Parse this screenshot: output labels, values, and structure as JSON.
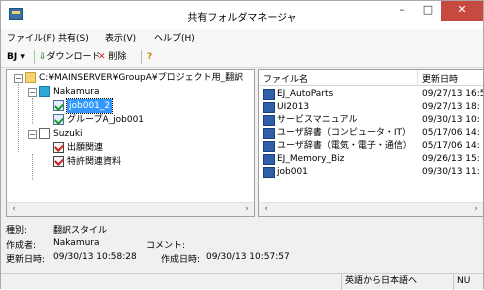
{
  "window": {
    "title": "共有フォルダマネージャ",
    "minimize": "–",
    "maximize": "□",
    "close": "✕"
  },
  "menu": [
    "ファイル(F)",
    "共有(S)",
    "表示(V)",
    "ヘルプ(H)"
  ],
  "toolbar": {
    "view_label": "BJ ▾",
    "download_label": "ダウンロード",
    "delete_label": "削除",
    "help_icon": "help-icon"
  },
  "tree": {
    "root": "C:¥MAINSERVER¥GroupA¥プロジェクト用_翻訳",
    "nodes": [
      {
        "label": "Nakamura"
      },
      {
        "label": "job001_2"
      },
      {
        "label": "グループA_job001"
      },
      {
        "label": "Suzuki"
      },
      {
        "label": "出願関連"
      },
      {
        "label": "特許関連資料"
      }
    ]
  },
  "list": {
    "headers": {
      "name": "ファイル名",
      "date": "更新日時"
    },
    "rows": [
      {
        "name": "EJ_AutoParts",
        "date": "09/27/13 16:5"
      },
      {
        "name": "UI2013",
        "date": "09/27/13 18:"
      },
      {
        "name": "サービスマニュアル",
        "date": "09/30/13 10:"
      },
      {
        "name": "ユーザ辞書（コンピュータ・IT）",
        "date": "05/17/06 14:"
      },
      {
        "name": "ユーザ辞書（電気・電子・通信）",
        "date": "05/17/06 14:"
      },
      {
        "name": "EJ_Memory_Biz",
        "date": "09/26/13 15:"
      },
      {
        "name": "job001",
        "date": "09/30/13 11:"
      }
    ]
  },
  "details": {
    "type_label": "種別:",
    "type_value": "翻訳スタイル",
    "author_label": "作成者:",
    "author_value": "Nakamura",
    "comment_label": "コメント:",
    "comment_value": "",
    "updated_label": "更新日時:",
    "updated_value": "09/30/13 10:58:28",
    "created_label": "作成日時:",
    "created_value": "09/30/13 10:57:57"
  },
  "status": {
    "direction": "英語から日本語へ",
    "mode": "NU"
  },
  "colors": {
    "selection": "#3399ff",
    "close_button": "#c74a41"
  }
}
